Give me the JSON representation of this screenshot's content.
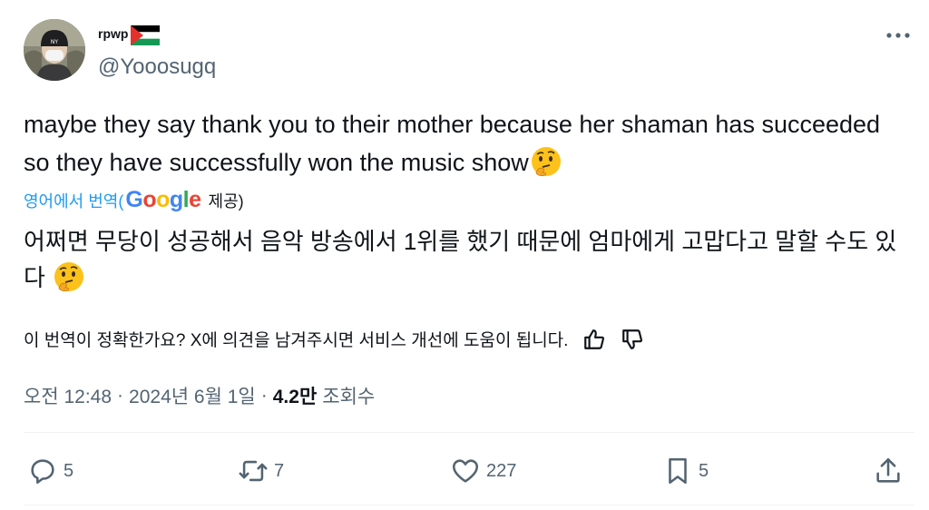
{
  "author": {
    "display_name": "rpwp",
    "flag": "palestine-flag-icon",
    "handle": "@Yooosugq"
  },
  "tweet": {
    "text": "maybe they say thank you to their mother because her shaman has succeeded so they have successfully won the music show",
    "emoji": "thinking-face-icon"
  },
  "translation_credit": {
    "prefix": "영어에서 번역(",
    "provider": "Google",
    "suffix": "제공)"
  },
  "translation": {
    "text": "어쩌면 무당이 성공해서 음악 방송에서 1위를 했기 때문에 엄마에게 고맙다고 말할 수도 있다 "
  },
  "feedback": {
    "prompt": "이 번역이 정확한가요? X에 의견을 남겨주시면 서비스 개선에 도움이 됩니다."
  },
  "meta": {
    "time": "오전 12:48",
    "separator": "·",
    "date": "2024년 6월 1일",
    "views_count": "4.2만",
    "views_label": "조회수"
  },
  "actions": {
    "replies": "5",
    "reposts": "7",
    "likes": "227",
    "bookmarks": "5"
  },
  "colors": {
    "text": "#0f1419",
    "secondary": "#536471",
    "link": "#1d9bf0",
    "google_blue": "#4285f4",
    "google_red": "#ea4335",
    "google_yellow": "#fbbc05",
    "google_green": "#34a853"
  }
}
